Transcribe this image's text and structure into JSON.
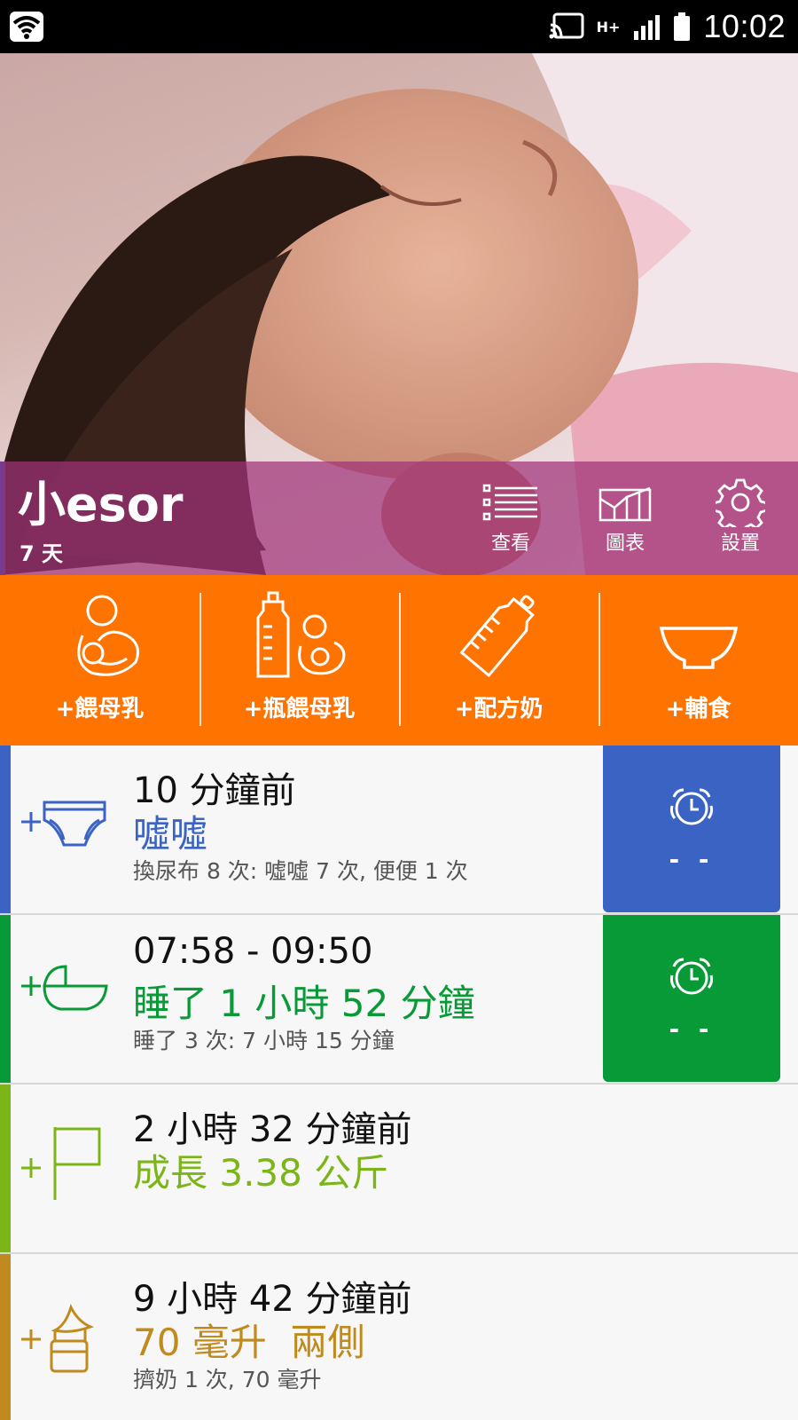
{
  "status_bar": {
    "network": "H+",
    "time": "10:02"
  },
  "baby": {
    "name": "小esor",
    "age": "7 天"
  },
  "header_buttons": [
    {
      "label": "查看",
      "icon": "list-icon"
    },
    {
      "label": "圖表",
      "icon": "chart-icon"
    },
    {
      "label": "設置",
      "icon": "gear-icon"
    }
  ],
  "actions": [
    {
      "label": "+餵母乳",
      "icon": "breastfeed-icon"
    },
    {
      "label": "+瓶餵母乳",
      "icon": "bottle-breastmilk-icon"
    },
    {
      "label": "+配方奶",
      "icon": "formula-bottle-icon"
    },
    {
      "label": "+輔食",
      "icon": "bowl-icon"
    }
  ],
  "rows": [
    {
      "time": "10 分鐘前",
      "main": "噓噓",
      "sub": "換尿布 8 次: 噓噓 7 次, 便便 1 次",
      "color": "#3b63c4",
      "icon": "diaper-icon",
      "timer": "- -"
    },
    {
      "time": "07:58 - 09:50",
      "main": "睡了 1 小時 52 分鐘",
      "sub": "睡了 3 次: 7 小時 15 分鐘",
      "color": "#079a36",
      "icon": "bassinet-icon",
      "timer": "- -"
    },
    {
      "time": "2 小時 32 分鐘前",
      "main": "成長 3.38 公斤",
      "sub": "",
      "color": "#7cb518",
      "icon": "flag-icon"
    },
    {
      "time": "9 小時 42 分鐘前",
      "main": "70 毫升  兩側",
      "sub": "擠奶 1 次, 70 毫升",
      "color": "#c08a1e",
      "icon": "breast-pump-icon"
    }
  ]
}
